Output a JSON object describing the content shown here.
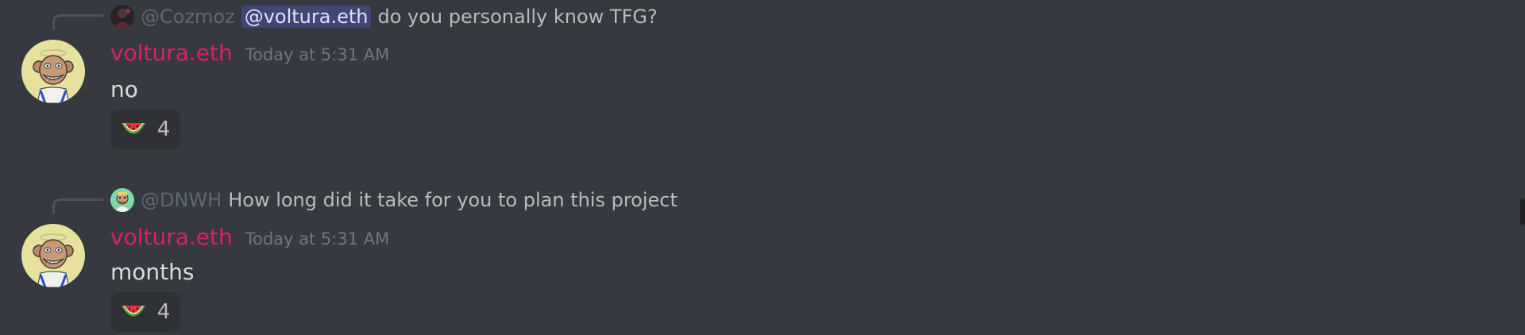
{
  "messages": [
    {
      "reply": {
        "author": "@Cozmoz",
        "mention": "@voltura.eth",
        "text": "do you personally know TFG?",
        "avatar_icon": "dark-user-avatar"
      },
      "author": "voltura.eth",
      "timestamp": "Today at 5:31 AM",
      "content": "no",
      "reaction": {
        "emoji": "watermelon-icon",
        "count": "4"
      }
    },
    {
      "reply": {
        "author": "@DNWH",
        "text": "How long did it take for you to plan this project",
        "avatar_icon": "ape-green-avatar"
      },
      "author": "voltura.eth",
      "timestamp": "Today at 5:31 AM",
      "content": "months",
      "reaction": {
        "emoji": "watermelon-icon",
        "count": "4"
      }
    }
  ],
  "colors": {
    "background": "#36393f",
    "username": "#e01d67",
    "mention_bg": "#414675",
    "reaction_bg": "#2f3136"
  }
}
